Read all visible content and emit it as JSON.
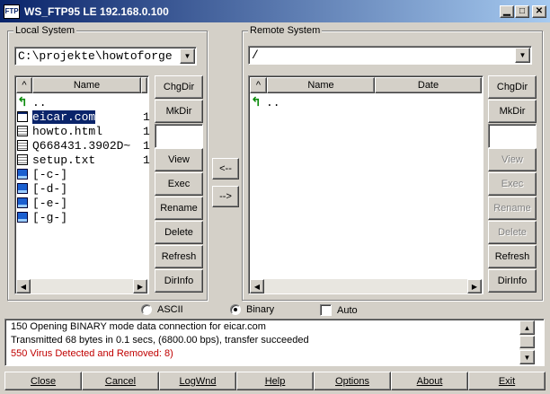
{
  "window": {
    "title": "WS_FTP95 LE 192.168.0.100",
    "icon_text": "FTP"
  },
  "local": {
    "group_label": "Local System",
    "path": "C:\\projekte\\howtoforge",
    "columns": {
      "sort": "^",
      "name": "Name"
    },
    "items": [
      {
        "icon": "up-folder-icon",
        "name": "..",
        "size": ""
      },
      {
        "icon": "exe-file-icon",
        "name": "eicar.com",
        "size": "1",
        "selected": true
      },
      {
        "icon": "html-file-icon",
        "name": "howto.html",
        "size": "1"
      },
      {
        "icon": "file-icon",
        "name": "Q668431.3902D~",
        "size": "1"
      },
      {
        "icon": "text-file-icon",
        "name": "setup.txt",
        "size": "1"
      },
      {
        "icon": "drive-icon",
        "name": "[-c-]",
        "size": ""
      },
      {
        "icon": "drive-icon",
        "name": "[-d-]",
        "size": ""
      },
      {
        "icon": "drive-icon",
        "name": "[-e-]",
        "size": ""
      },
      {
        "icon": "drive-icon",
        "name": "[-g-]",
        "size": ""
      }
    ],
    "buttons": [
      "ChgDir",
      "MkDir",
      "",
      "View",
      "Exec",
      "Rename",
      "Delete",
      "Refresh",
      "DirInfo"
    ]
  },
  "remote": {
    "group_label": "Remote System",
    "path": "/",
    "columns": {
      "sort": "^",
      "name": "Name",
      "date": "Date"
    },
    "items": [
      {
        "icon": "up-folder-icon",
        "name": ".."
      }
    ],
    "buttons": [
      "ChgDir",
      "MkDir",
      "",
      "View",
      "Exec",
      "Rename",
      "Delete",
      "Refresh",
      "DirInfo"
    ],
    "disabled": [
      "View",
      "Exec",
      "Rename",
      "Delete"
    ]
  },
  "transfer": {
    "to_local": "<--",
    "to_remote": "-->"
  },
  "mode": {
    "ascii_label": "ASCII",
    "binary_label": "Binary",
    "auto_label": "Auto",
    "selected": "Binary",
    "auto_checked": false
  },
  "log": {
    "lines": [
      {
        "text": "150 Opening BINARY mode data connection for eicar.com",
        "color": "#000000"
      },
      {
        "text": "Transmitted 68 bytes in 0.1 secs, (6800.00 bps), transfer succeeded",
        "color": "#000000"
      },
      {
        "text": "550 Virus Detected and Removed: 8)",
        "color": "#c00000"
      }
    ]
  },
  "bottom_buttons": [
    "Close",
    "Cancel",
    "LogWnd",
    "Help",
    "Options",
    "About",
    "Exit"
  ],
  "colors": {
    "titlebar": "#0a246a",
    "selection": "#0a246a",
    "error": "#c00000",
    "face": "#d4d0c8"
  }
}
